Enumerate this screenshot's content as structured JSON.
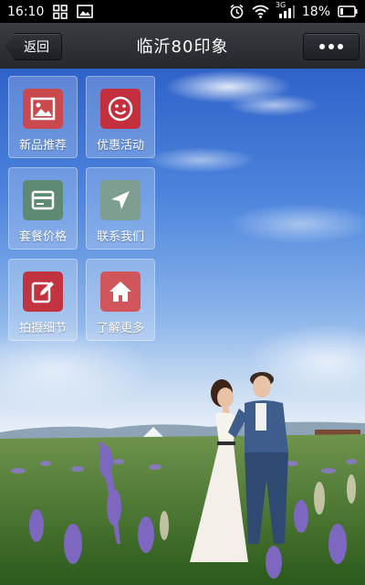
{
  "status_bar": {
    "time": "16:10",
    "battery_percent": "18%",
    "network_label": "3G"
  },
  "title_bar": {
    "back_label": "返回",
    "title": "临沂80印象"
  },
  "menu": {
    "items": [
      {
        "label": "新品推荐",
        "icon": "image-icon",
        "color": "#c9494e"
      },
      {
        "label": "优惠活动",
        "icon": "smiley-icon",
        "color": "#c32f3d"
      },
      {
        "label": "套餐价格",
        "icon": "card-icon",
        "color": "#5e8a74"
      },
      {
        "label": "联系我们",
        "icon": "navigation-arrow-icon",
        "color": "#7e9f8f"
      },
      {
        "label": "拍摄细节",
        "icon": "edit-icon",
        "color": "#c1333f"
      },
      {
        "label": "了解更多",
        "icon": "home-icon",
        "color": "#d0565b"
      }
    ]
  }
}
